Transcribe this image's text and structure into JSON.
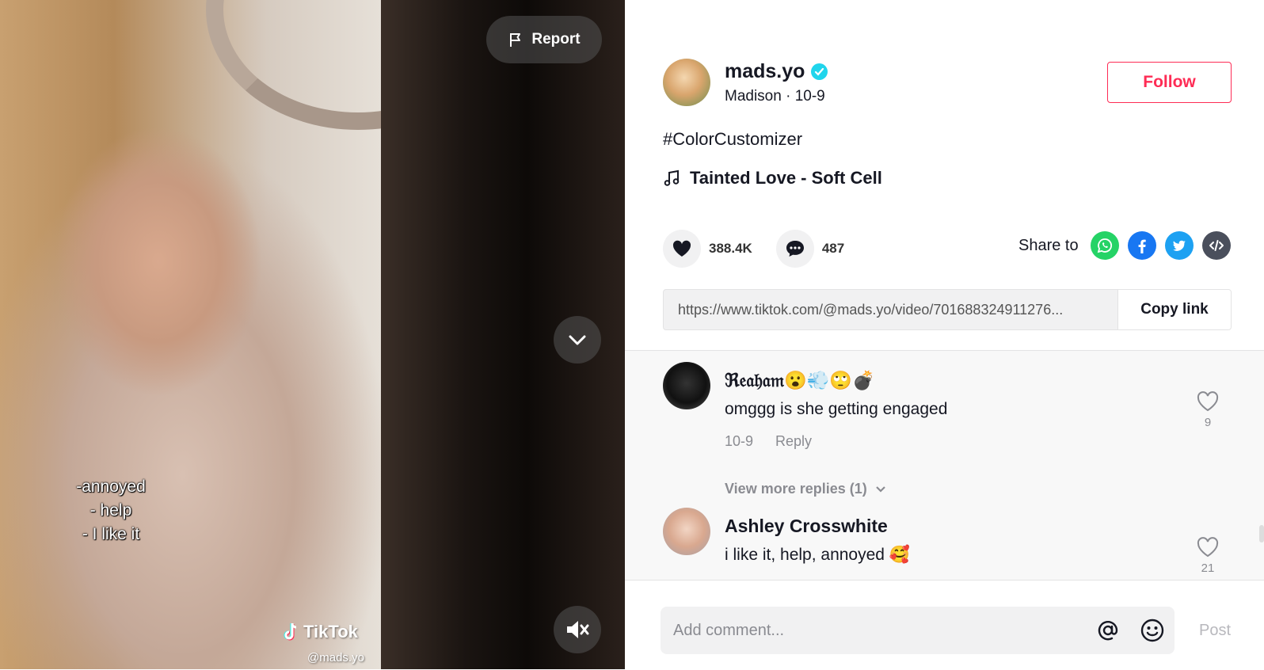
{
  "video": {
    "caption_lines": [
      "-annoyed",
      "- help",
      "- I like it"
    ],
    "watermark_brand": "TikTok",
    "watermark_handle": "@mads.yo",
    "report_label": "Report"
  },
  "author": {
    "username": "mads.yo",
    "display_name_date": "Madison · 10-9",
    "follow_label": "Follow"
  },
  "post": {
    "description": "#ColorCustomizer",
    "music": "Tainted Love - Soft Cell"
  },
  "actions": {
    "likes": "388.4K",
    "comments": "487",
    "share_label": "Share to",
    "share_icons": [
      "whatsapp-icon",
      "facebook-icon",
      "twitter-icon",
      "embed-icon"
    ]
  },
  "link": {
    "url": "https://www.tiktok.com/@mads.yo/video/701688324911276...",
    "copy_label": "Copy link"
  },
  "comments": [
    {
      "name": "ℜ𝔢𝔞𝔥𝔞𝔪😮💨🙄💣",
      "text": "omggg is she getting engaged",
      "date": "10-9",
      "reply_label": "Reply",
      "likes": "9",
      "more_replies": "View more replies (1)"
    },
    {
      "name": "Ashley Crosswhite",
      "text": "i like it, help, annoyed 🥰",
      "likes": "21"
    }
  ],
  "comment_bar": {
    "placeholder": "Add comment...",
    "post_label": "Post"
  },
  "colors": {
    "accent": "#fe2c55",
    "verified": "#20d5ec",
    "whatsapp": "#25d366",
    "facebook": "#1877f2",
    "twitter": "#1da1f2",
    "embed": "#4a4f5c"
  }
}
